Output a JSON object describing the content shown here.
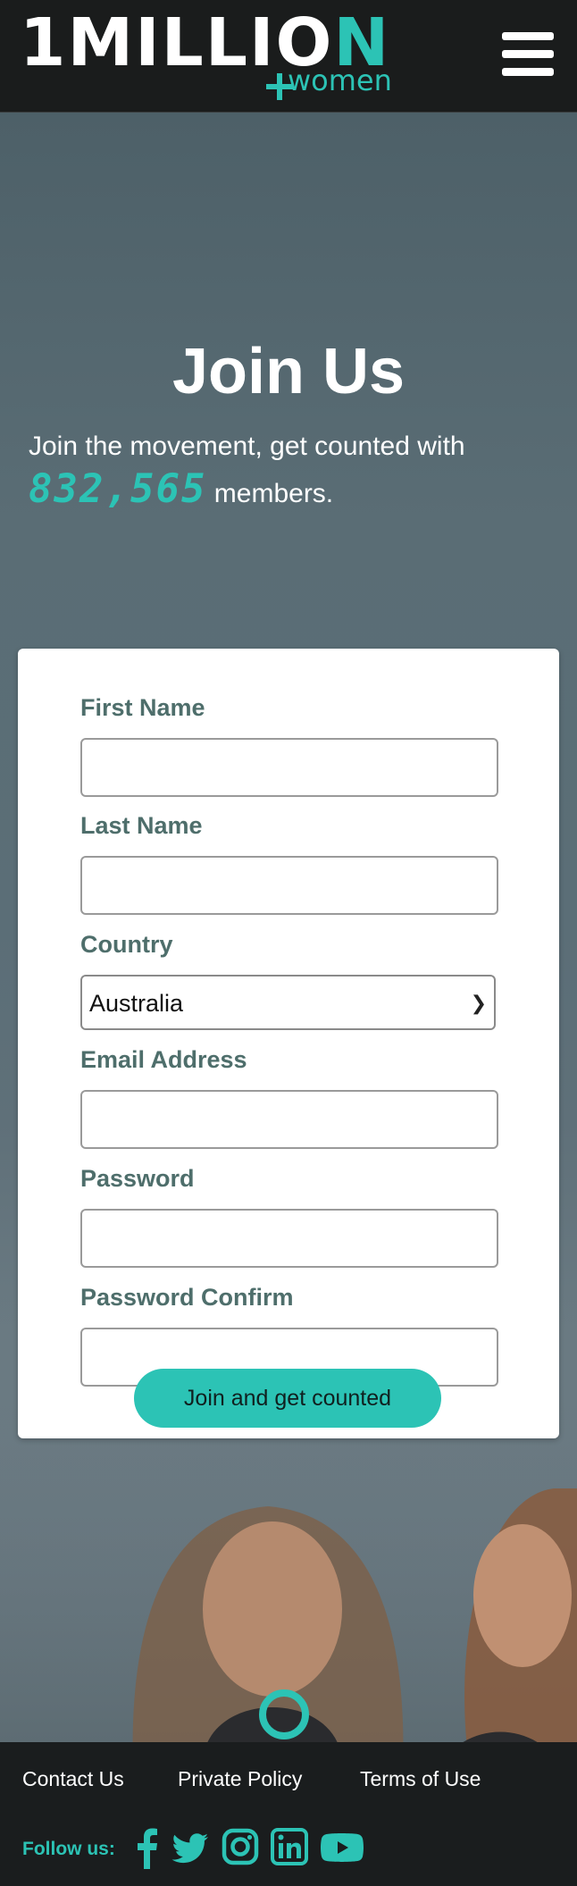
{
  "header": {
    "logo_text_main": "1MILLIO",
    "logo_text_o": "N",
    "logo_text_sub": "women"
  },
  "hero": {
    "title": "Join Us",
    "subtitle_prefix": "Join the movement, get counted with",
    "member_count": "832,565",
    "subtitle_suffix": "members."
  },
  "form": {
    "fields": [
      {
        "label": "First Name",
        "value": ""
      },
      {
        "label": "Last Name",
        "value": ""
      },
      {
        "label": "Country",
        "value": "Australia"
      },
      {
        "label": "Email Address",
        "value": ""
      },
      {
        "label": "Password",
        "value": ""
      },
      {
        "label": "Password Confirm",
        "value": ""
      }
    ],
    "submit_label": "Join and get counted"
  },
  "footer": {
    "links": [
      "Contact Us",
      "Private Policy",
      "Terms of Use"
    ],
    "follow_label": "Follow us:",
    "social_icons": [
      "facebook-icon",
      "twitter-icon",
      "instagram-icon",
      "linkedin-icon",
      "youtube-icon"
    ]
  },
  "colors": {
    "accent": "#2cc3b5",
    "label": "#4e6e6b",
    "header_bg": "#1a1c1c"
  }
}
